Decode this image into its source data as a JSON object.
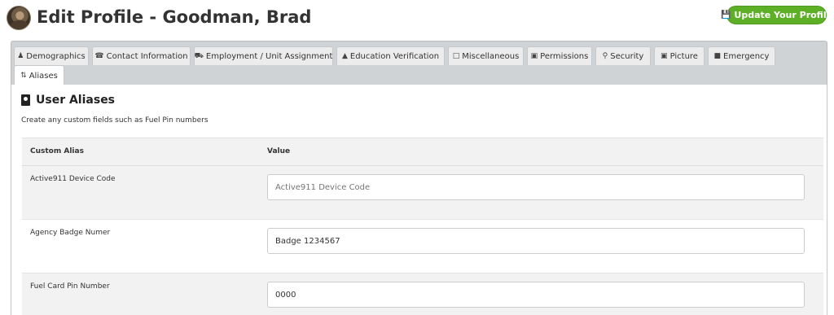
{
  "header": {
    "title": "Edit Profile - Goodman, Brad",
    "update_button": "Update Your Profile",
    "update_icon": "save-icon"
  },
  "tabs": [
    {
      "label": "Demographics",
      "icon": "user-icon"
    },
    {
      "label": "Contact Information",
      "icon": "phone-icon"
    },
    {
      "label": "Employment / Unit Assignment",
      "icon": "truck-icon"
    },
    {
      "label": "Education Verification",
      "icon": "graduation-cap-icon"
    },
    {
      "label": "Miscellaneous",
      "icon": "file-icon"
    },
    {
      "label": "Permissions",
      "icon": "lock-icon"
    },
    {
      "label": "Security",
      "icon": "key-icon"
    },
    {
      "label": "Picture",
      "icon": "image-icon"
    },
    {
      "label": "Emergency",
      "icon": "contact-card-icon"
    },
    {
      "label": "Aliases",
      "icon": "sort-alpha-icon",
      "active": true
    }
  ],
  "section": {
    "title": "User Aliases",
    "description": "Create any custom fields such as Fuel Pin numbers"
  },
  "table": {
    "headers": {
      "alias": "Custom Alias",
      "value": "Value"
    },
    "rows": [
      {
        "label": "Active911 Device Code",
        "value": "",
        "placeholder": "Active911 Device Code"
      },
      {
        "label": "Agency Badge Numer",
        "value": "Badge 1234567",
        "placeholder": ""
      },
      {
        "label": "Fuel Card Pin Number",
        "value": "0000",
        "placeholder": ""
      }
    ]
  },
  "colors": {
    "accent_green": "#5db025",
    "tabbar_bg": "#cfd3d6",
    "row_alt_bg": "#f2f2f2"
  }
}
